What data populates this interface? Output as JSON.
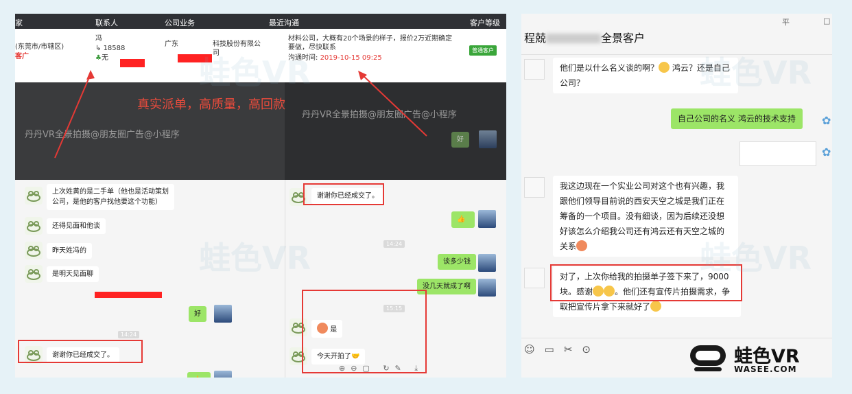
{
  "crm_header": {
    "col_region": "家",
    "col_contact": "联系人",
    "col_business": "公司业务",
    "col_recent": "最近沟通",
    "col_level": "客户等级"
  },
  "crm_row": {
    "region": "(东莞市/市辖区)",
    "region_tag": "客广",
    "contact_name": "冯",
    "contact_phone": "18588",
    "contact_wechat": "无",
    "company_prefix": "广东",
    "company_suffix": "科技股份有限公司",
    "recent_text": "材料公司，大概有20个场景的样子，报价2万近期确定要做，尽快联系",
    "recent_time_label": "沟通时间:",
    "recent_time": "2019-10-15 09:25",
    "level_badge": "普通客户"
  },
  "slogan": "真实派单，高质量，高回款",
  "chat_titles": {
    "left": "丹丹VR全景拍摄@朋友圈广告@小程序",
    "mid": "丹丹VR全景拍摄@朋友圈广告@小程序"
  },
  "left_chat": {
    "msgs": [
      "上次姓黄的是二手单（他也是活动策划公司，是他的客户找他要这个功能）",
      "还得见面和他谈",
      "昨天姓冯的",
      "是明天见面聊",
      "好",
      "谢谢你已经成交了。"
    ],
    "time": "14:24"
  },
  "mid_chat": {
    "msgs": [
      "谢谢你已经成交了。",
      "谈多少钱",
      "没几天就成了啊",
      "是",
      "今天开拍了"
    ],
    "time1": "14:24",
    "time2": "15:15",
    "top_green": "好"
  },
  "right_chat": {
    "title_prefix": "程兢",
    "title_suffix": "全景客户",
    "msgs": [
      "他们是以什么名义谈的啊？",
      "鸿云？还是自己公司？",
      "自己公司的名义 鸿云的技术支持",
      "我这边现在一个实业公司对这个也有兴趣，我跟他们领导目前说的西安天空之城是我们正在筹备的一个项目。没有细谈，因为后续还没想好该怎么介绍我公司还有鸿云还有天空之城的关系",
      "对了，上次你给我的拍摄单子签下来了，9000块。感谢",
      "。他们还有宣传片拍摄需求，争取把宣传片拿下来就好了"
    ],
    "win_controls": [
      "平",
      "□"
    ]
  },
  "logo": {
    "cn": "蛙色VR",
    "en": "WASEE.COM"
  },
  "watermark": "蛙色VR"
}
